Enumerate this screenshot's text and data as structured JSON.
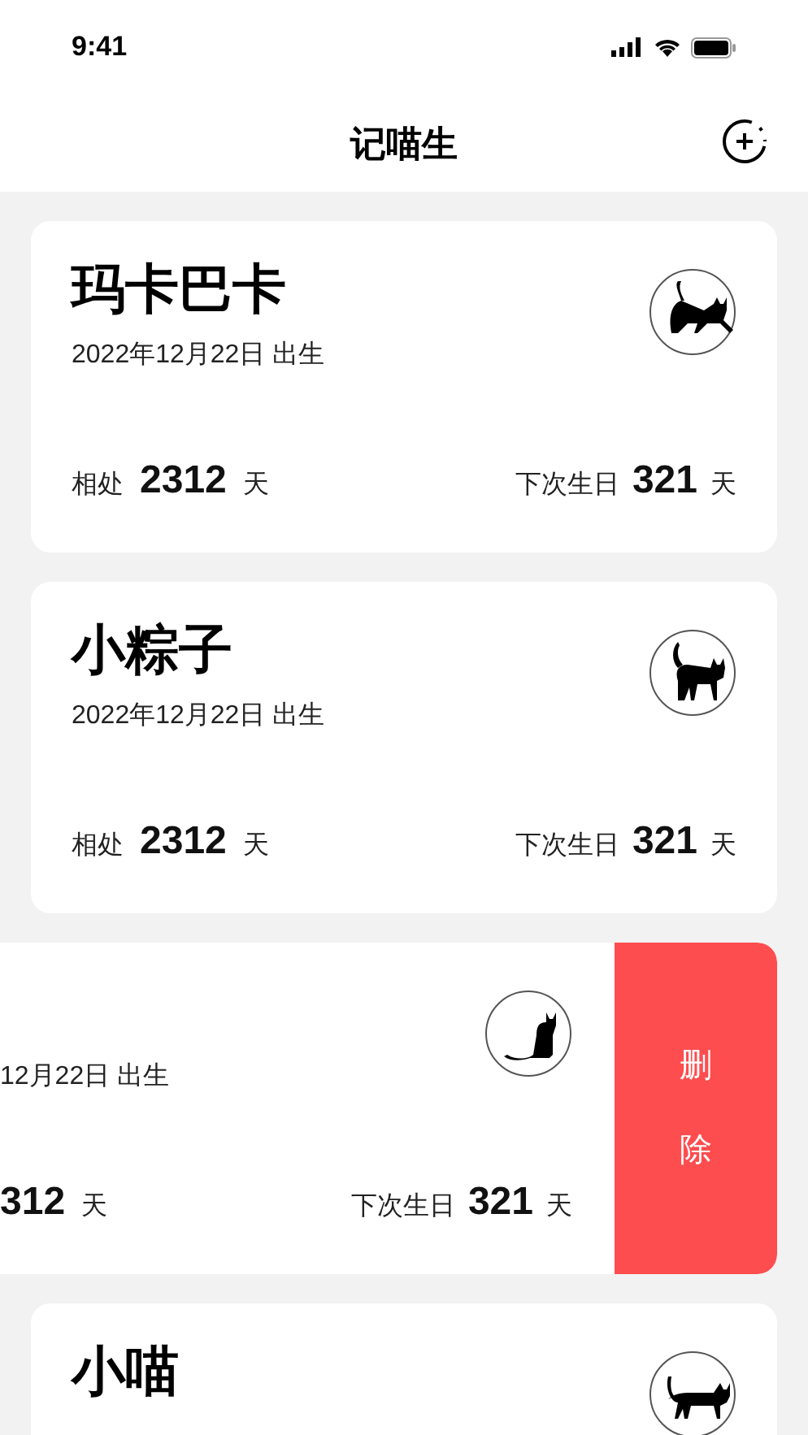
{
  "status_bar": {
    "time": "9:41"
  },
  "header": {
    "title": "记喵生"
  },
  "cats": [
    {
      "swiped": false,
      "name": "玛卡巴卡",
      "birth": "2022年12月22日 出生",
      "together_label": "相处",
      "together_days": "2312",
      "together_unit": "天",
      "next_label": "下次生日",
      "next_days": "321",
      "next_unit": "天"
    },
    {
      "swiped": false,
      "name": "小粽子",
      "birth": "2022年12月22日 出生",
      "together_label": "相处",
      "together_days": "2312",
      "together_unit": "天",
      "next_label": "下次生日",
      "next_days": "321",
      "next_unit": "天"
    },
    {
      "swiped": true,
      "birth": "12月22日 出生",
      "together_days": "312",
      "together_unit": "天",
      "next_label": "下次生日",
      "next_days": "321",
      "next_unit": "天",
      "delete_chars": [
        "删",
        "除"
      ]
    },
    {
      "swiped": false,
      "name": "小喵"
    }
  ]
}
